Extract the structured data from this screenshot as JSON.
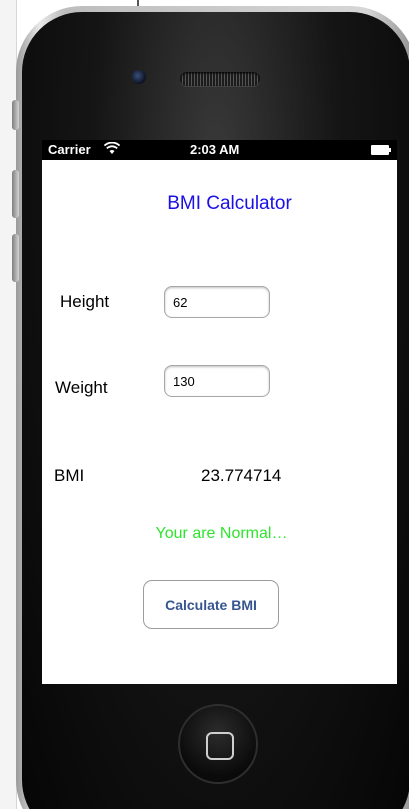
{
  "status_bar": {
    "carrier": "Carrier",
    "wifi_icon": "wifi-icon",
    "time": "2:03 AM",
    "battery_icon": "battery-icon"
  },
  "app": {
    "title": "BMI Calculator",
    "title_color": "#1a10e6",
    "height_label": "Height",
    "height_value": "62",
    "weight_label": "Weight",
    "weight_value": "130",
    "bmi_label": "BMI",
    "bmi_value": "23.774714",
    "status_message": "Your are Normal…",
    "status_color": "#2ee52e",
    "calculate_button": "Calculate BMI",
    "button_text_color": "#37558f"
  },
  "device": {
    "home_button_icon": "home-square-icon",
    "camera_icon": "camera-icon",
    "speaker_icon": "speaker-grille-icon"
  }
}
